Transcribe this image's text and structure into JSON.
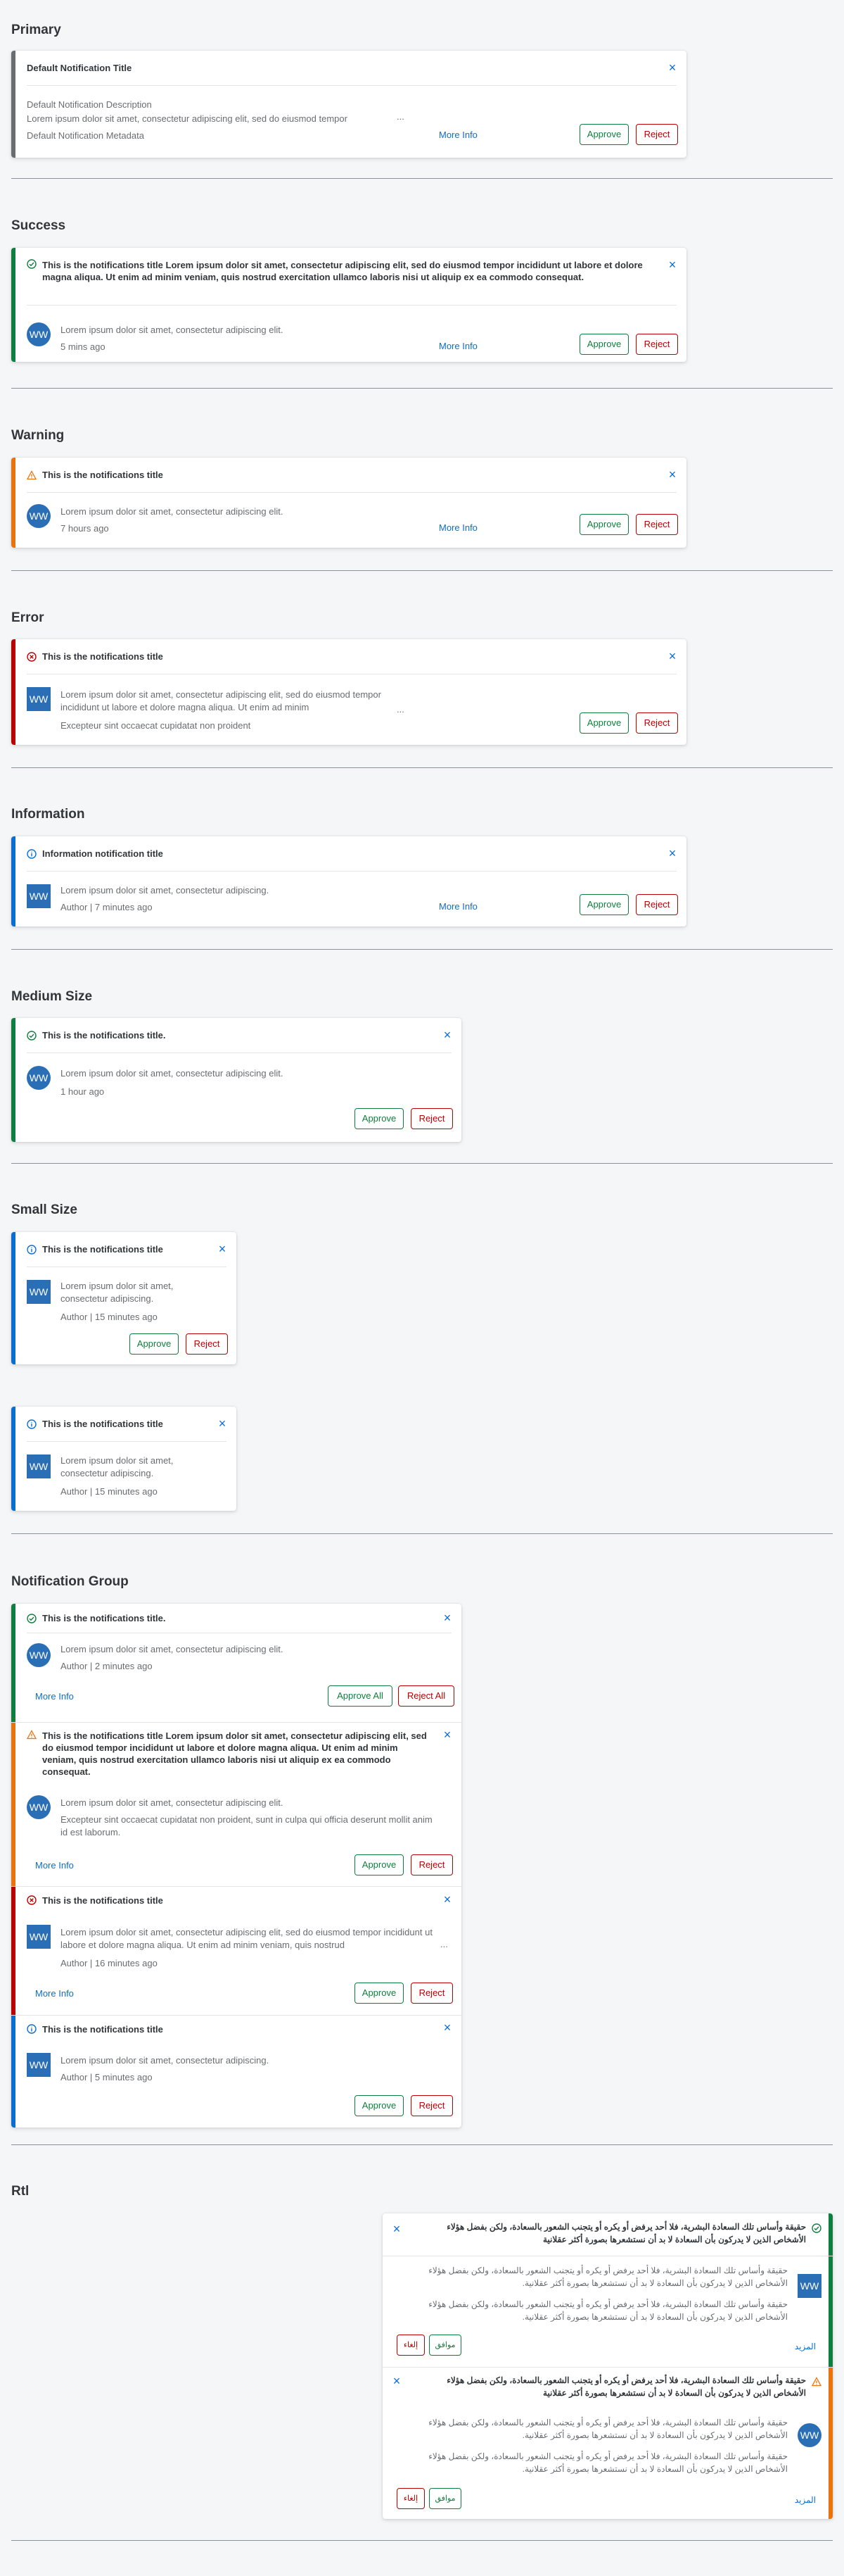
{
  "colors": {
    "neutral": "#6a6d70",
    "success": "#107e3e",
    "warning": "#e9730c",
    "error": "#bb0000",
    "information": "#0a6ed1",
    "avatar": "#2a6fb5"
  },
  "common": {
    "approve": "Approve",
    "reject": "Reject",
    "more_info": "More Info",
    "approve_all": "Approve All",
    "reject_all": "Reject All",
    "close": "×",
    "ellipsis": "...",
    "avatar": "WW"
  },
  "primary": {
    "section": "Primary",
    "title": "Default Notification Title",
    "description": "Default Notification Description",
    "body": "Lorem ipsum dolor sit amet, consectetur adipiscing elit, sed do eiusmod tempor",
    "metadata": "Default Notification Metadata"
  },
  "success": {
    "section": "Success",
    "title": "This is the notifications title Lorem ipsum dolor sit amet, consectetur adipiscing elit, sed do eiusmod tempor incididunt ut labore et dolore magna aliqua. Ut enim ad minim veniam, quis nostrud exercitation ullamco laboris nisi ut aliquip ex ea commodo consequat.",
    "body": "Lorem ipsum dolor sit amet, consectetur adipiscing elit.",
    "meta": "5 mins ago"
  },
  "warning": {
    "section": "Warning",
    "title": "This is the notifications title",
    "body": "Lorem ipsum dolor sit amet, consectetur adipiscing elit.",
    "meta": "7 hours ago"
  },
  "error": {
    "section": "Error",
    "title": "This is the notifications title",
    "body": "Lorem ipsum dolor sit amet, consectetur adipiscing elit, sed do eiusmod tempor incididunt ut labore et dolore magna aliqua. Ut enim ad minim",
    "meta": "Excepteur sint occaecat cupidatat non proident"
  },
  "information": {
    "section": "Information",
    "title": "Information notification title",
    "body": "Lorem ipsum dolor sit amet, consectetur adipiscing.",
    "meta": "Author | 7 minutes ago"
  },
  "medium": {
    "section": "Medium Size",
    "title": "This is the notifications title.",
    "body": "Lorem ipsum dolor sit amet, consectetur adipiscing elit.",
    "meta": "1 hour ago"
  },
  "small": {
    "section": "Small Size",
    "title": "This is the notifications title",
    "body": "Lorem ipsum dolor sit amet, consectetur adipiscing.",
    "meta": "Author | 15 minutes ago"
  },
  "group": {
    "section": "Notification Group",
    "item1": {
      "title": "This is the notifications title.",
      "body": "Lorem ipsum dolor sit amet, consectetur adipiscing elit.",
      "meta": "Author | 2 minutes ago"
    },
    "item2": {
      "title": "This is the notifications title Lorem ipsum dolor sit amet, consectetur adipiscing elit, sed do eiusmod tempor incididunt ut labore et dolore magna aliqua. Ut enim ad minim veniam, quis nostrud exercitation ullamco laboris nisi ut aliquip ex ea commodo consequat.",
      "body": "Lorem ipsum dolor sit amet, consectetur adipiscing elit.",
      "meta": "Excepteur sint occaecat cupidatat non proident, sunt in culpa qui officia deserunt mollit anim id est laborum."
    },
    "item3": {
      "title": "This is the notifications title",
      "body": "Lorem ipsum dolor sit amet, consectetur adipiscing elit, sed do eiusmod tempor incididunt ut labore et dolore magna aliqua. Ut enim ad minim veniam, quis nostrud",
      "meta": "Author | 16 minutes ago"
    },
    "item4": {
      "title": "This is the notifications title",
      "body": "Lorem ipsum dolor sit amet, consectetur adipiscing.",
      "meta": "Author | 5 minutes ago"
    }
  },
  "rtl": {
    "section": "Rtl",
    "title": "حقيقة وأساس تلك السعادة البشرية، فلا أحد يرفض أو يكره أو يتجنب الشعور بالسعادة، ولكن بفضل هؤلاء الأشخاص الذين لا يدركون بأن السعادة لا بد أن نستشعرها بصورة أكثر عقلانية",
    "body": "حقيقة وأساس تلك السعادة البشرية، فلا أحد يرفض أو يكره أو يتجنب الشعور بالسعادة، ولكن بفضل هؤلاء الأشخاص الذين لا يدركون بأن السعادة لا بد أن نستشعرها بصورة أكثر عقلانية.",
    "approve": "موافق",
    "reject": "إلغاء",
    "more": "المزيد"
  }
}
